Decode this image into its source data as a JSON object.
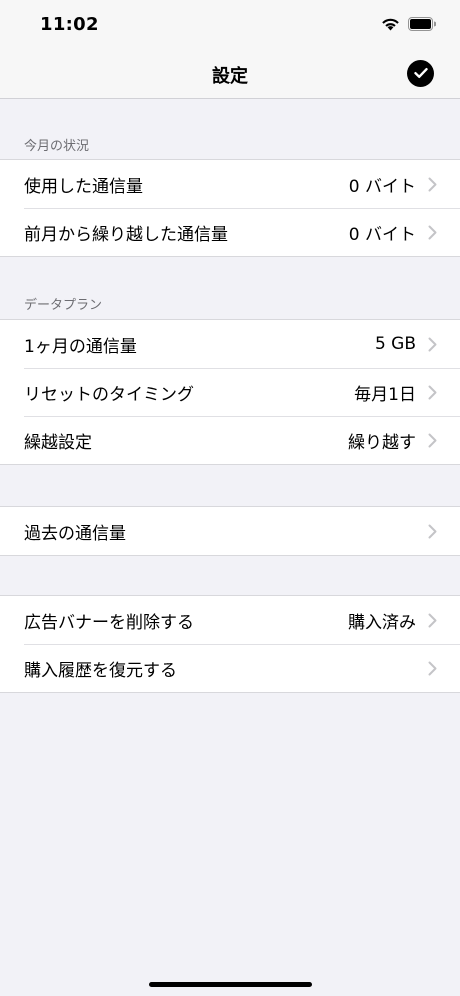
{
  "status_bar": {
    "time": "11:02",
    "icons": [
      "wifi-icon",
      "battery-icon"
    ]
  },
  "nav": {
    "title": "設定",
    "done_icon": "checkmark-circle-icon"
  },
  "sections": {
    "this_month": {
      "header": "今月の状況",
      "rows": [
        {
          "label": "使用した通信量",
          "value": "0 バイト"
        },
        {
          "label": "前月から繰り越した通信量",
          "value": "0 バイト"
        }
      ]
    },
    "data_plan": {
      "header": "データプラン",
      "rows": [
        {
          "label": "1ヶ月の通信量",
          "value": "5 GB"
        },
        {
          "label": "リセットのタイミング",
          "value": "毎月1日"
        },
        {
          "label": "繰越設定",
          "value": "繰り越す"
        }
      ]
    },
    "history": {
      "rows": [
        {
          "label": "過去の通信量"
        }
      ]
    },
    "purchase": {
      "rows": [
        {
          "label": "広告バナーを削除する",
          "value": "購入済み"
        },
        {
          "label": "購入履歴を復元する"
        }
      ]
    }
  },
  "colors": {
    "background": "#F2F2F7",
    "cell": "#FFFFFF",
    "header_text": "#6D6D72",
    "chevron": "#C4C4C7"
  }
}
